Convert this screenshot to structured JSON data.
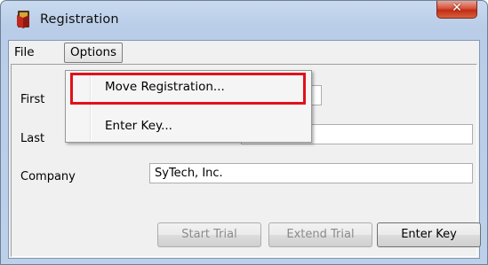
{
  "window": {
    "title": "Registration",
    "close_glyph": "✕",
    "icon": "registration-app-icon"
  },
  "menubar": {
    "file": "File",
    "options": "Options"
  },
  "options_menu": {
    "items": [
      {
        "label": "Move Registration..."
      },
      {
        "label": "Enter Key..."
      }
    ],
    "highlight_color": "#e1111a"
  },
  "form": {
    "first_label": "First",
    "last_label": "Last",
    "company_label": "Company",
    "company_value": "SyTech, Inc."
  },
  "buttons": {
    "start_trial": "Start Trial",
    "extend_trial": "Extend Trial",
    "enter_key": "Enter Key"
  }
}
